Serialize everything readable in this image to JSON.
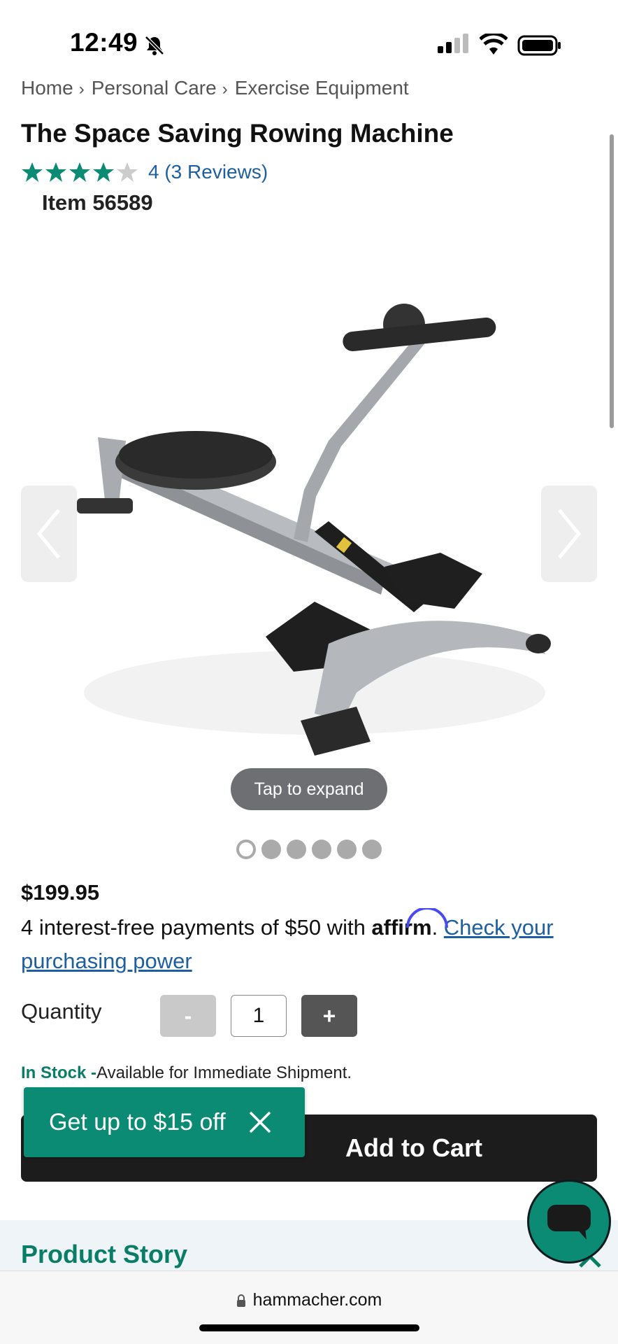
{
  "status_bar": {
    "time": "12:49",
    "icons": [
      "bell-slash-icon",
      "signal-icon",
      "wifi-icon",
      "battery-icon"
    ]
  },
  "breadcrumb": [
    "Home",
    "Personal Care",
    "Exercise Equipment"
  ],
  "product": {
    "title": "The Space Saving Rowing Machine",
    "rating_value": 4,
    "rating_max": 5,
    "rating_text": "4 (3 Reviews)",
    "item_number": "Item 56589",
    "image_alt": "rowing-machine-image",
    "tap_to_expand": "Tap to expand",
    "image_count": 6,
    "active_image_index": 0,
    "price": "$199.95"
  },
  "financing": {
    "text_before": "4 interest-free payments of $50 with ",
    "brand": "affirm",
    "text_after": ". ",
    "link": "Check your purchasing power"
  },
  "quantity": {
    "label": "Quantity",
    "minus": "-",
    "value": "1",
    "plus": "+"
  },
  "stock": {
    "status": "In Stock -",
    "detail": "Available for Immediate Shipment."
  },
  "cart": {
    "add_to_cart": "Add to Cart"
  },
  "promo": {
    "text": "Get up to $15 off"
  },
  "sections": {
    "product_story": "Product Story"
  },
  "browser": {
    "url": "hammacher.com"
  },
  "colors": {
    "accent": "#0b8a74",
    "link": "#1d5fa0",
    "button_dark": "#1c1c1c"
  }
}
